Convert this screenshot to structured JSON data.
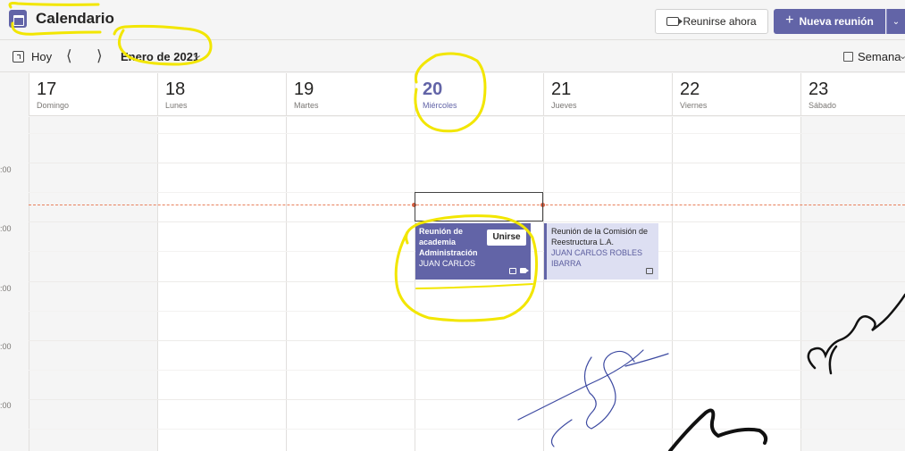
{
  "header": {
    "title": "Calendario",
    "meet_now": "Reunirse ahora",
    "new_meeting": "Nueva reunión"
  },
  "nav": {
    "today": "Hoy",
    "month": "Enero de 2021",
    "view": "Semana"
  },
  "days": [
    {
      "num": "17",
      "name": "Domingo"
    },
    {
      "num": "18",
      "name": "Lunes"
    },
    {
      "num": "19",
      "name": "Martes"
    },
    {
      "num": "20",
      "name": "Miércoles"
    },
    {
      "num": "21",
      "name": "Jueves"
    },
    {
      "num": "22",
      "name": "Viernes"
    },
    {
      "num": "23",
      "name": "Sábado"
    }
  ],
  "times": [
    ":00",
    ":00",
    ":00",
    ":00",
    ":00"
  ],
  "events": [
    {
      "title": "Reunión de academia Administración",
      "organizer": "JUAN CARLOS",
      "join": "Unirse"
    },
    {
      "title": "Reunión de la Comisión de Reestructura L.A.",
      "organizer": "JUAN CARLOS ROBLES IBARRA"
    }
  ],
  "colors": {
    "accent": "#6264a7",
    "highlight": "#f2e600",
    "now_line": "#e8805c"
  },
  "icons": [
    "calendar-app-icon",
    "video-camera-icon",
    "plus-icon",
    "chevron-down-icon",
    "today-icon",
    "chevron-left-icon",
    "chevron-right-icon",
    "week-view-icon",
    "chat-icon"
  ]
}
